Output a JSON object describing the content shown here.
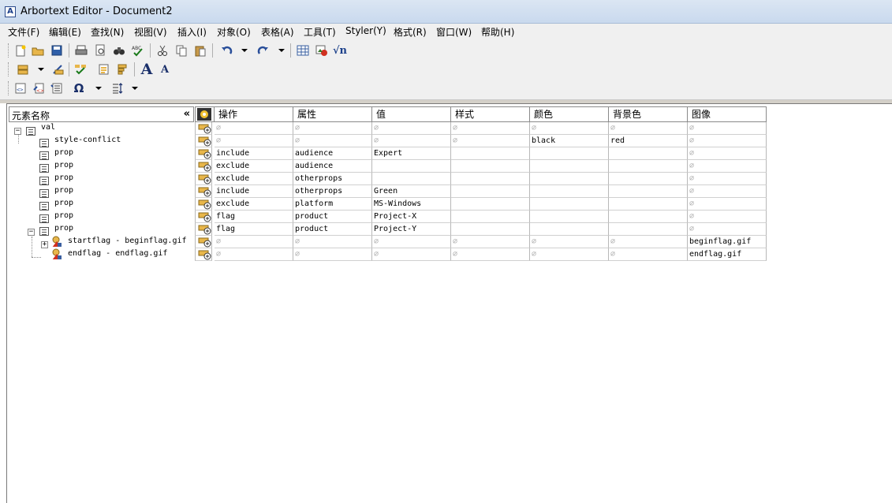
{
  "window": {
    "title": "Arbortext Editor - Document2"
  },
  "menu": [
    "文件(F)",
    "编辑(E)",
    "查找(N)",
    "视图(V)",
    "插入(I)",
    "对象(O)",
    "表格(A)",
    "工具(T)",
    "Styler(Y)",
    "格式(R)",
    "窗口(W)",
    "帮助(H)"
  ],
  "tree": {
    "header": "元素名称",
    "collapse_glyph": "«",
    "rows": [
      {
        "label": "val"
      },
      {
        "label": "style-conflict"
      },
      {
        "label": "prop"
      },
      {
        "label": "prop"
      },
      {
        "label": "prop"
      },
      {
        "label": "prop"
      },
      {
        "label": "prop"
      },
      {
        "label": "prop"
      },
      {
        "label": "prop"
      },
      {
        "label": "startflag - beginflag.gif"
      },
      {
        "label": "endflag - endflag.gif"
      }
    ]
  },
  "table": {
    "headers": [
      "操作",
      "属性",
      "值",
      "样式",
      "颜色",
      "背景色",
      "图像"
    ],
    "empty_glyph": "∅",
    "rows": [
      [
        "∅",
        "∅",
        "∅",
        "∅",
        "∅",
        "∅",
        "∅"
      ],
      [
        "∅",
        "∅",
        "∅",
        "∅",
        "black",
        "red",
        "∅"
      ],
      [
        "include",
        "audience",
        "Expert",
        "",
        "",
        "",
        "∅"
      ],
      [
        "exclude",
        "audience",
        "",
        "",
        "",
        "",
        "∅"
      ],
      [
        "exclude",
        "otherprops",
        "",
        "",
        "",
        "",
        "∅"
      ],
      [
        "include",
        "otherprops",
        "Green",
        "",
        "",
        "",
        "∅"
      ],
      [
        "exclude",
        "platform",
        "MS-Windows",
        "",
        "",
        "",
        "∅"
      ],
      [
        "flag",
        "product",
        "Project-X",
        "",
        "",
        "",
        "∅"
      ],
      [
        "flag",
        "product",
        "Project-Y",
        "",
        "",
        "",
        "∅"
      ],
      [
        "∅",
        "∅",
        "∅",
        "∅",
        "∅",
        "∅",
        "beginflag.gif"
      ],
      [
        "∅",
        "∅",
        "∅",
        "∅",
        "∅",
        "∅",
        "endflag.gif"
      ]
    ]
  },
  "toolbar": {
    "font_larger": "A",
    "font_smaller": "A",
    "omega": "Ω",
    "sqrt": "√n"
  }
}
